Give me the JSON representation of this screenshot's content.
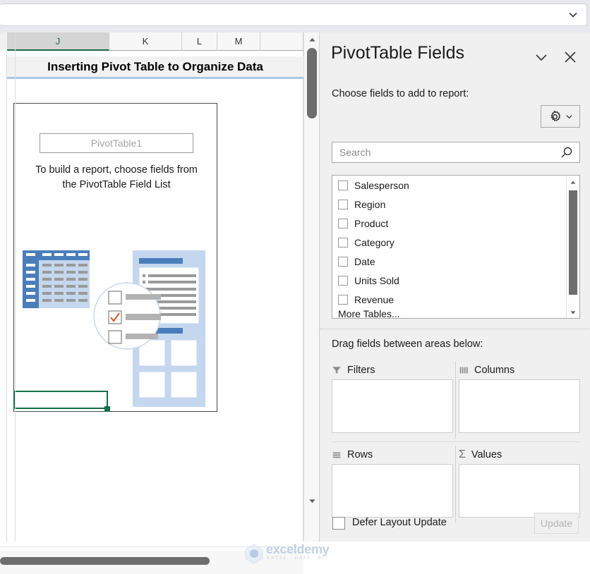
{
  "formula_bar": {
    "value": "",
    "expand_icon": "chevron-down-icon"
  },
  "sheet": {
    "column_headers": [
      "J",
      "K",
      "L",
      "M"
    ],
    "selected_column": "J",
    "title_cell": "Inserting Pivot Table to Organize Data",
    "pivot_placeholder": {
      "name": "PivotTable1",
      "hint_line1": "To build a report, choose fields from",
      "hint_line2": "the PivotTable Field List"
    },
    "watermark": {
      "brand": "exceldemy",
      "tagline": "EXCEL · DATA · BI"
    },
    "scrollbars": {
      "vertical_up_icon": "triangle-up-icon",
      "vertical_down_icon": "triangle-down-icon",
      "horizontal_present": true
    }
  },
  "pane": {
    "title": "PivotTable Fields",
    "collapse_icon": "chevron-down-icon",
    "close_icon": "close-icon",
    "choose_label": "Choose fields to add to report:",
    "tools_icon": "gear-icon",
    "tools_chevron_icon": "chevron-down-icon",
    "search": {
      "placeholder": "Search",
      "value": "",
      "icon": "search-icon"
    },
    "fields": [
      {
        "label": "Salesperson",
        "checked": false
      },
      {
        "label": "Region",
        "checked": false
      },
      {
        "label": "Product",
        "checked": false
      },
      {
        "label": "Category",
        "checked": false
      },
      {
        "label": "Date",
        "checked": false
      },
      {
        "label": "Units Sold",
        "checked": false
      },
      {
        "label": "Revenue",
        "checked": false
      },
      {
        "label": "More Tables...",
        "checked": false
      }
    ],
    "field_list_scroll": {
      "up_icon": "triangle-up-icon",
      "down_icon": "triangle-down-icon"
    },
    "drag_label": "Drag fields between areas below:",
    "areas": [
      {
        "label": "Filters",
        "icon": "filter-funnel-icon",
        "items": []
      },
      {
        "label": "Columns",
        "icon": "columns-icon",
        "items": []
      },
      {
        "label": "Rows",
        "icon": "rows-icon",
        "items": []
      },
      {
        "label": "Values",
        "icon": "sigma-icon",
        "items": []
      }
    ],
    "defer": {
      "label": "Defer Layout Update",
      "checked": false
    },
    "update_button": {
      "label": "Update",
      "enabled": false
    }
  },
  "colors": {
    "pane_bg": "#f0f0f0",
    "accent_green": "#15704a",
    "title_underline": "#a8c8e8",
    "illus_blue": "#4a7ebb",
    "illus_light_blue": "#c4d7ee",
    "check_orange": "#d9622b"
  }
}
